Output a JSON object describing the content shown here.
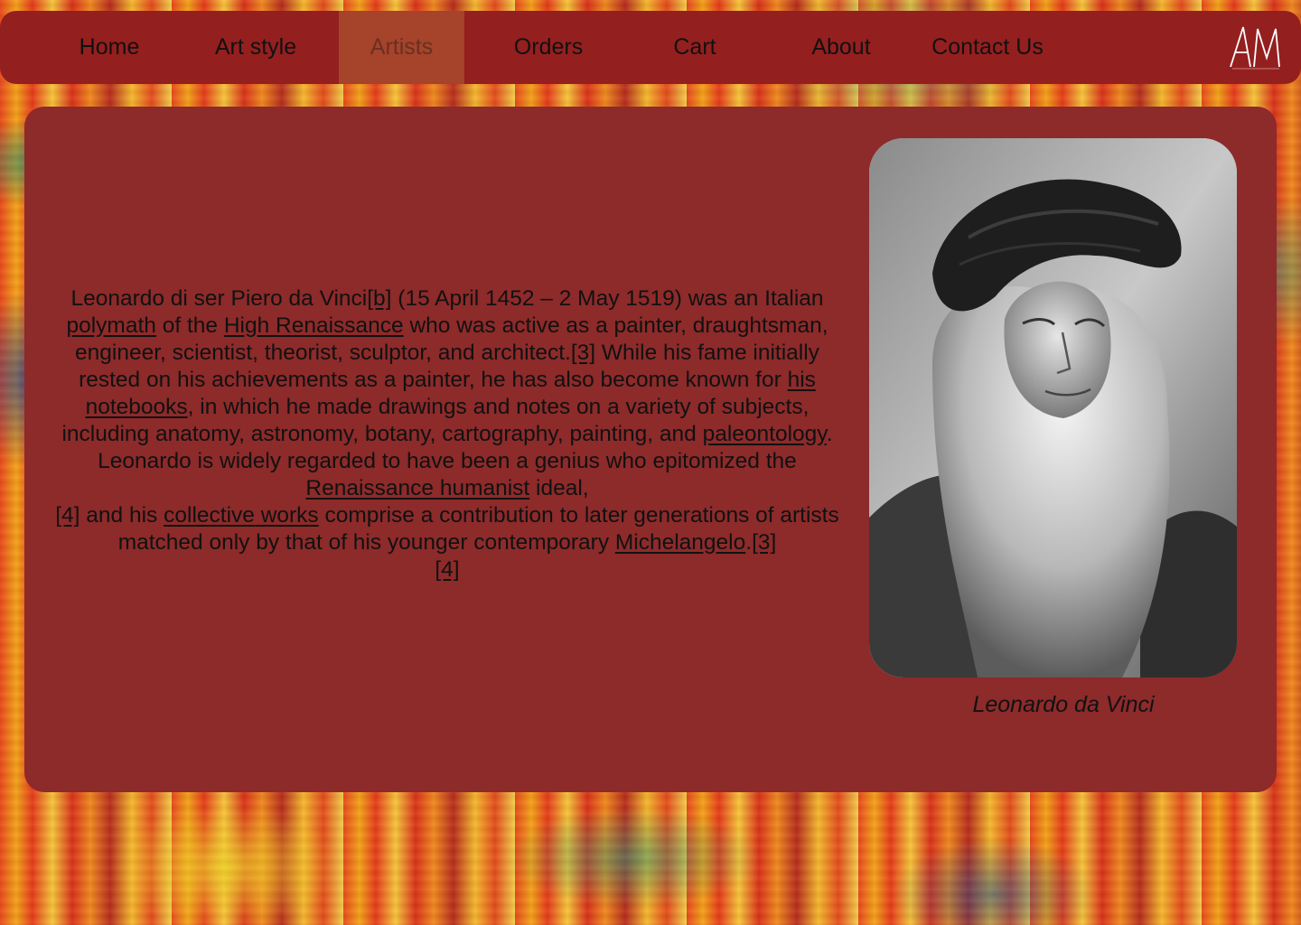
{
  "nav": {
    "items": [
      {
        "label": "Home",
        "active": false
      },
      {
        "label": "Art style",
        "active": false
      },
      {
        "label": "Artists",
        "active": true
      },
      {
        "label": "Orders",
        "active": false
      },
      {
        "label": "Cart",
        "active": false
      },
      {
        "label": "About",
        "active": false
      },
      {
        "label": "Contact Us",
        "active": false
      }
    ],
    "logo_text": "AM"
  },
  "artist": {
    "bio": {
      "t1": "Leonardo di ser Piero da Vinci",
      "ref_b": "[b]",
      "t2": " (15 April 1452 – 2 May 1519) was an Italian ",
      "link_polymath": "polymath",
      "t3": " of the ",
      "link_high_renaissance": "High Renaissance",
      "t4": " who was active as a painter, draughtsman, engineer, scientist, theorist, sculptor, and architect.",
      "ref_3a": "[3]",
      "t5": " While his fame initially rested on his achievements as a painter, he has also become known for ",
      "link_notebooks": "his notebooks",
      "t6": ", in which he made drawings and notes on a variety of subjects, including anatomy, astronomy, botany, cartography, painting, and ",
      "link_paleontology": "paleontology",
      "t7": ". Leonardo is widely regarded to have been a genius who epitomized the ",
      "link_renaissance_humanist": "Renaissance humanist",
      "t8": " ideal,",
      "ref_4a": "[4]",
      "t9": " and his ",
      "link_collective_works": "collective works",
      "t10": " comprise a contribution to later generations of artists matched only by that of his younger contemporary ",
      "link_michelangelo": "Michelangelo",
      "t11": ".",
      "ref_3b": "[3]",
      "ref_4b": "[4]"
    },
    "caption": "Leonardo da Vinci"
  },
  "colors": {
    "nav_bg": "#941f1f",
    "nav_active_bg": "#a5432b",
    "card_bg": "#8d2a2a",
    "text": "#111111"
  }
}
